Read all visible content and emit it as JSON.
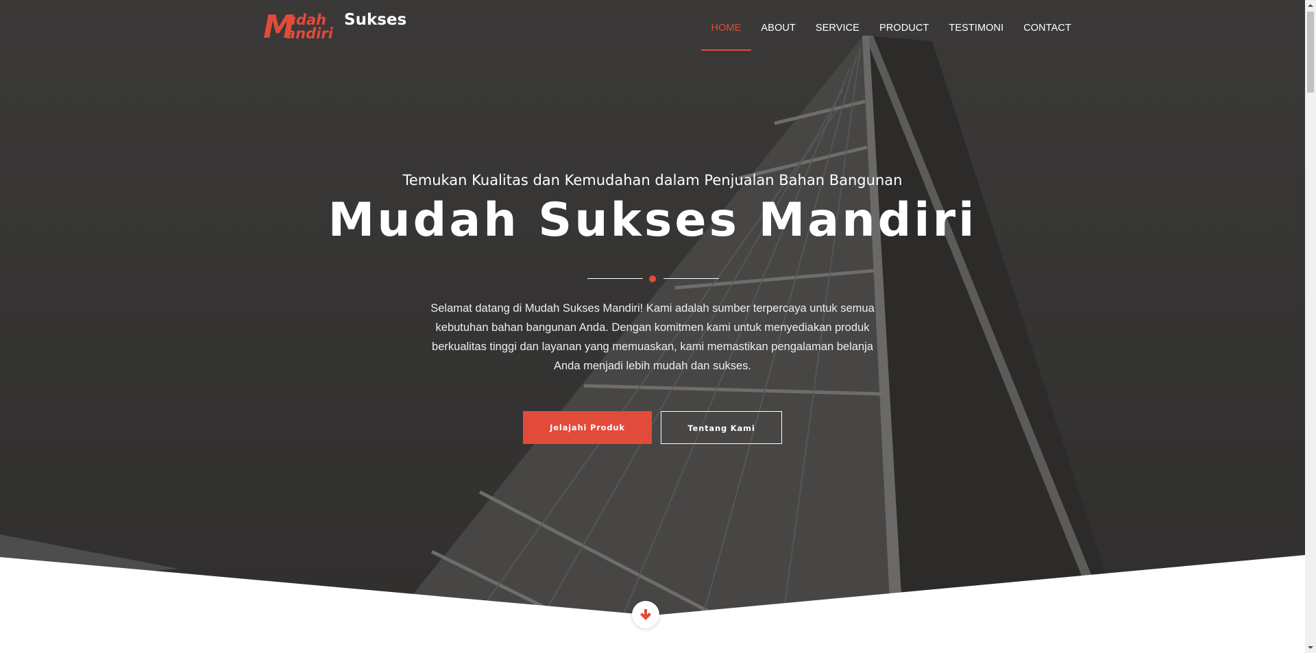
{
  "logo": {
    "text_m": "M",
    "text_udah": "udah",
    "text_andiri": "andiri",
    "text_sukses": "Sukses",
    "accent": "#e24b3b"
  },
  "nav": {
    "items": [
      {
        "label": "HOME",
        "active": true
      },
      {
        "label": "ABOUT"
      },
      {
        "label": "SERVICE"
      },
      {
        "label": "PRODUCT"
      },
      {
        "label": "TESTIMONI"
      },
      {
        "label": "CONTACT"
      }
    ]
  },
  "hero": {
    "subtitle": "Temukan Kualitas dan Kemudahan dalam Penjualan Bahan Bangunan",
    "title": "Mudah Sukses Mandiri",
    "description": "Selamat datang di Mudah Sukses Mandiri! Kami adalah sumber terpercaya untuk semua kebutuhan bahan bangunan Anda. Dengan komitmen kami untuk menyediakan produk berkualitas tinggi dan layanan yang memuaskan, kami memastikan pengalaman belanja Anda menjadi lebih mudah dan sukses.",
    "primary_button": "Jelajahi Produk",
    "secondary_button": "Tentang Kami",
    "scroll_icon": "arrow-down-icon"
  },
  "colors": {
    "accent": "#e24b3b",
    "hero_bg": "#353434",
    "white": "#ffffff"
  }
}
